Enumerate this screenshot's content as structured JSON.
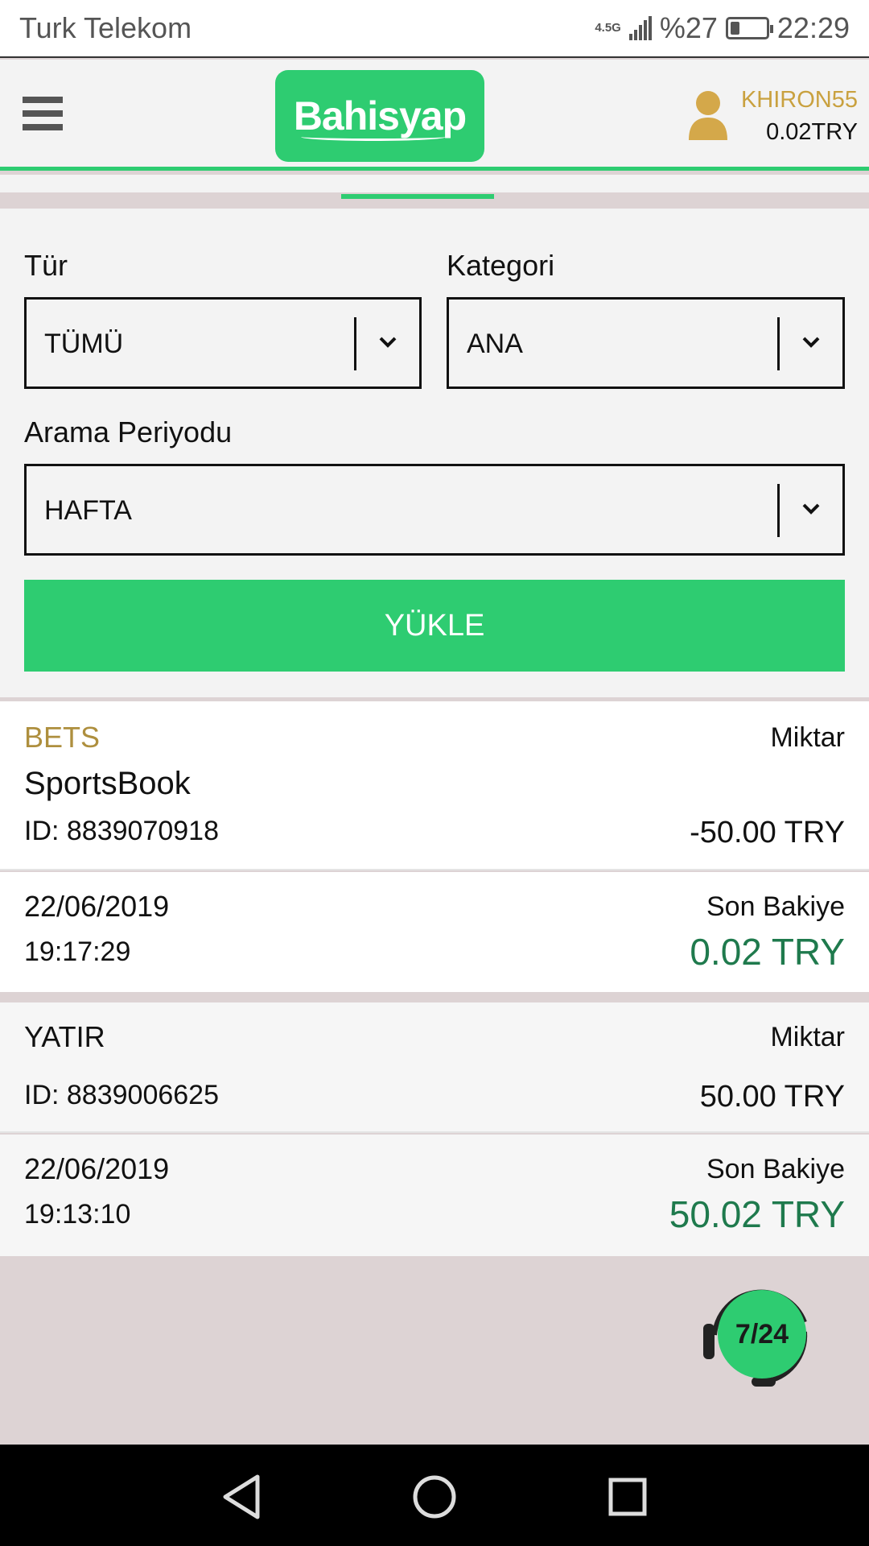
{
  "status_bar": {
    "carrier": "Turk Telekom",
    "network": "4.5G",
    "battery": "%27",
    "battery_level": 0.27,
    "time": "22:29"
  },
  "header": {
    "logo": "Bahisyap",
    "username": "KHIRON55",
    "balance": "0.02TRY"
  },
  "filters": {
    "type_label": "Tür",
    "type_value": "TÜMÜ",
    "category_label": "Kategori",
    "category_value": "ANA",
    "period_label": "Arama Periyodu",
    "period_value": "HAFTA",
    "load_button": "YÜKLE"
  },
  "transactions": [
    {
      "type": "BETS",
      "subtype": "SportsBook",
      "id": "ID: 8839070918",
      "amount_label": "Miktar",
      "amount": "-50.00 TRY",
      "date": "22/06/2019",
      "time": "19:17:29",
      "balance_label": "Son Bakiye",
      "balance": "0.02 TRY"
    },
    {
      "type": "YATIR",
      "id": "ID: 8839006625",
      "amount_label": "Miktar",
      "amount": "50.00 TRY",
      "date": "22/06/2019",
      "time": "19:13:10",
      "balance_label": "Son Bakiye",
      "balance": "50.02 TRY"
    }
  ],
  "support": {
    "label": "7/24"
  },
  "colors": {
    "accent": "#2ecc71",
    "gold": "#c9a13f",
    "balance_green": "#1f7a4d"
  }
}
